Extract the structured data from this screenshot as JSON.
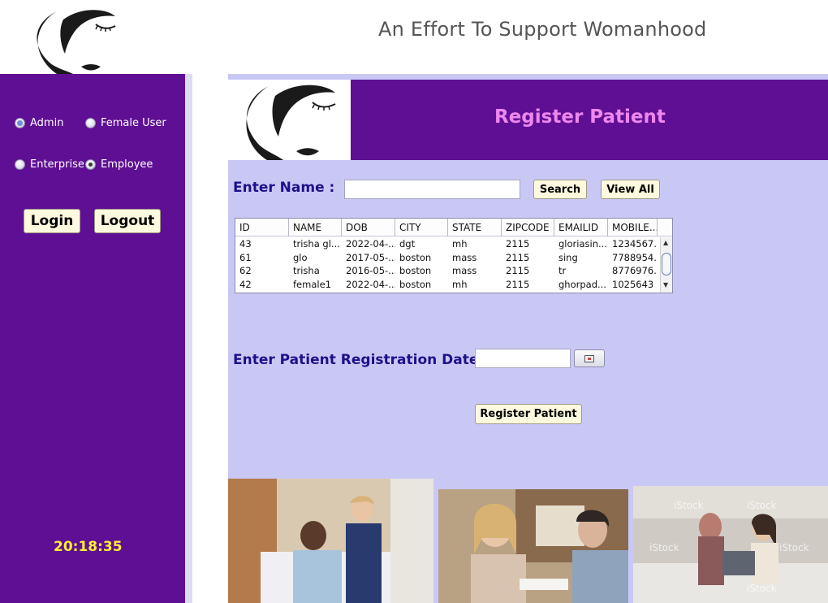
{
  "header": {
    "tagline": "An Effort To Support Womanhood"
  },
  "sidebar": {
    "roles": [
      {
        "label": "Admin",
        "selected": false
      },
      {
        "label": "Female User",
        "selected": false
      },
      {
        "label": "Enterprise",
        "selected": false
      },
      {
        "label": "Employee",
        "selected": true
      }
    ],
    "login_label": "Login",
    "logout_label": "Logout",
    "clock": "20:18:35"
  },
  "panel": {
    "title": "Register Patient",
    "name_label": "Enter Name :",
    "name_value": "",
    "search_label": "Search",
    "view_all_label": "View All",
    "date_label": "Enter Patient Registration Date :",
    "date_value": "",
    "register_label": "Register Patient"
  },
  "table": {
    "columns": [
      "ID",
      "NAME",
      "DOB",
      "CITY",
      "STATE",
      "ZIPCODE",
      "EMAILID",
      "MOBILE..."
    ],
    "rows": [
      [
        "43",
        "trisha gl...",
        "2022-04-...",
        "dgt",
        "mh",
        "2115",
        "gloriasin...",
        "1234567..."
      ],
      [
        "61",
        "glo",
        "2017-05-...",
        "boston",
        "mass",
        "2115",
        "sing",
        "7788954..."
      ],
      [
        "62",
        "trisha",
        "2016-05-...",
        "boston",
        "mass",
        "2115",
        "tr",
        "8776976..."
      ],
      [
        "42",
        "female1",
        "2022-04-...",
        "boston",
        "mh",
        "2115",
        "ghorpad...",
        "1025643"
      ]
    ]
  },
  "colors": {
    "sidebar": "#5f0f94",
    "panel_bg": "#c9c8f5",
    "title": "#ee88ee",
    "label": "#1f0f8a",
    "clock": "#ffee33",
    "button": "#fdf9de"
  },
  "icons": {
    "calendar": "calendar-icon",
    "logo": "woman-face-logo"
  }
}
